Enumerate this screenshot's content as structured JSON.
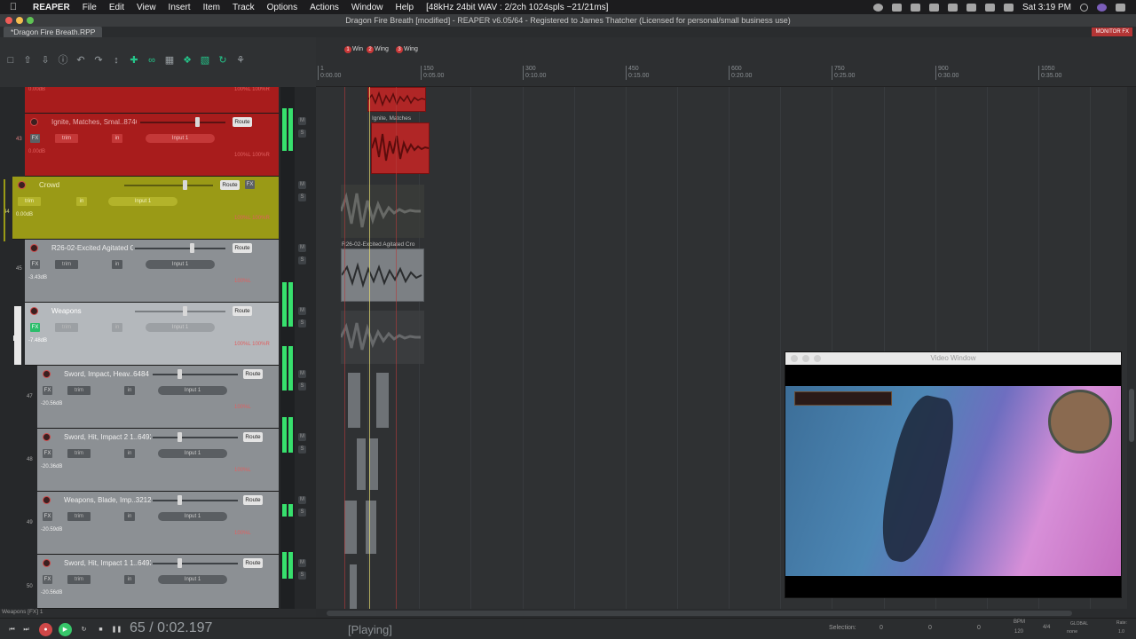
{
  "menubar": {
    "app": "REAPER",
    "items": [
      "File",
      "Edit",
      "View",
      "Insert",
      "Item",
      "Track",
      "Options",
      "Actions",
      "Window",
      "Help"
    ],
    "format_info": "[48kHz 24bit WAV : 2/2ch 1024spls ~21/21ms]",
    "clock": "Sat 3:19 PM"
  },
  "window": {
    "title": "Dragon Fire Breath [modified] - REAPER v6.05/64 - Registered to James Thatcher (Licensed for personal/small business use)",
    "project_tab": "*Dragon Fire Breath.RPP",
    "monitor_fx": "MONITOR FX"
  },
  "markers": [
    {
      "num": "1",
      "label": "Win"
    },
    {
      "num": "2",
      "label": "Wing"
    },
    {
      "num": "3",
      "label": "Wing"
    }
  ],
  "ruler": {
    "ticks": [
      {
        "bar": "1",
        "time": "0:00.00"
      },
      {
        "bar": "150",
        "time": "0:05.00"
      },
      {
        "bar": "300",
        "time": "0:10.00"
      },
      {
        "bar": "450",
        "time": "0:15.00"
      },
      {
        "bar": "600",
        "time": "0:20.00"
      },
      {
        "bar": "750",
        "time": "0:25.00"
      },
      {
        "bar": "900",
        "time": "0:30.00"
      },
      {
        "bar": "1050",
        "time": "0:35.00"
      }
    ]
  },
  "tracks": [
    {
      "name": "",
      "vol": "0.00dB",
      "pan": "100%L 100%R",
      "num": "",
      "color": "#a81c1c"
    },
    {
      "name": "Ignite, Matches, Smal..8746",
      "vol": "0.00dB",
      "pan": "100%L 100%R",
      "num": "43",
      "color": "#a81c1c",
      "input": "Input 1"
    },
    {
      "name": "Crowd",
      "vol": "0.00dB",
      "pan": "100%L 100%R",
      "num": "44",
      "color": "#9a9a16",
      "input": "Input 1"
    },
    {
      "name": "R26-02-Excited Agitated Cr",
      "vol": "-3.43dB",
      "pan": "100%L",
      "num": "45",
      "color": "#8c9094",
      "input": "Input 1"
    },
    {
      "name": "Weapons",
      "vol": "-7.48dB",
      "pan": "100%L 100%R",
      "num": "46",
      "color": "#b4b8bc",
      "input": "Input 1"
    },
    {
      "name": "Sword, Impact, Heav..6484",
      "vol": "-20.56dB",
      "pan": "100%L",
      "num": "47",
      "color": "#8c9094",
      "input": "Input 1"
    },
    {
      "name": "Sword, Hit, Impact 2 1..6492",
      "vol": "-20.36dB",
      "pan": "100%L",
      "num": "48",
      "color": "#8c9094",
      "input": "Input 1"
    },
    {
      "name": "Weapons, Blade, Imp..3212",
      "vol": "-20.59dB",
      "pan": "100%L",
      "num": "49",
      "color": "#8c9094",
      "input": "Input 1"
    },
    {
      "name": "Sword, Hit, Impact 1 1..6493",
      "vol": "-20.56dB",
      "pan": "",
      "num": "50",
      "color": "#8c9094",
      "input": "Input 1"
    }
  ],
  "labels": {
    "route": "Route",
    "fx": "FX",
    "trim": "trim",
    "in": "in",
    "mute": "M",
    "solo": "S"
  },
  "items": [
    {
      "label": "Ignite, Matches"
    },
    {
      "label": "R26-02-Excited Agitated Cro"
    }
  ],
  "video_window": {
    "title": "Video Window"
  },
  "transport": {
    "position": "65 / 0:02.197",
    "state": "[Playing]",
    "selection_label": "Selection:",
    "sel_start": "0",
    "sel_end": "0",
    "sel_len": "0",
    "bpm_label": "BPM",
    "bpm": "120",
    "timesig": "4/4",
    "global": "GLOBAL",
    "none": "none",
    "rate_label": "Rate:",
    "rate": "1.0"
  },
  "status": "Weapons [FX] 1",
  "colors": {
    "accent_green": "#37e06d",
    "record_red": "#d04848",
    "play_green": "#37c76a"
  }
}
